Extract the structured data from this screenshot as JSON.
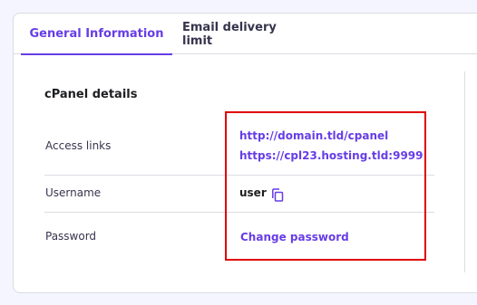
{
  "tabs": [
    {
      "label": "General Information",
      "active": true
    },
    {
      "label": "Email delivery limit",
      "active": false
    }
  ],
  "section": {
    "title": "cPanel details"
  },
  "rows": {
    "access": {
      "label": "Access links",
      "links": [
        "http://domain.tld/cpanel",
        "https://cpl23.hosting.tld:9999"
      ]
    },
    "username": {
      "label": "Username",
      "value": "user",
      "icon": "copy-icon"
    },
    "password": {
      "label": "Password",
      "action": "Change password"
    }
  },
  "colors": {
    "accent": "#673de6",
    "highlight": "#e00000",
    "background": "#f4f5ff"
  }
}
